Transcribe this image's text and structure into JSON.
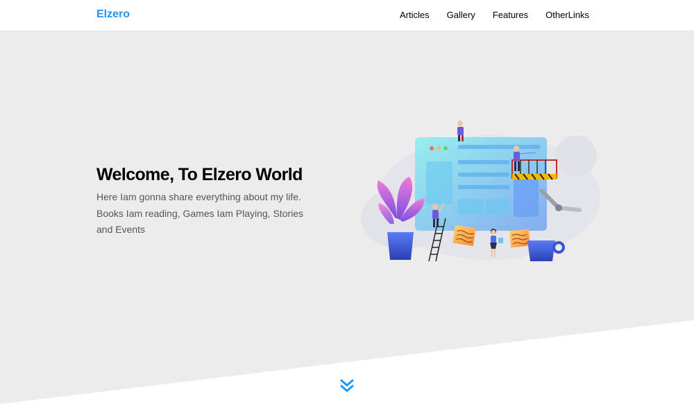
{
  "header": {
    "logo": "Elzero",
    "nav": [
      "Articles",
      "Gallery",
      "Features",
      "OtherLinks"
    ]
  },
  "hero": {
    "title": "Welcome, To Elzero World",
    "description": "Here Iam gonna share everything about my life. Books Iam reading, Games Iam Playing, Stories and Events"
  },
  "icons": {
    "scroll_down": "double-chevron-down-icon"
  },
  "colors": {
    "brand": "#2196f3",
    "hero_background": "#ececec",
    "text_muted": "#555555"
  }
}
